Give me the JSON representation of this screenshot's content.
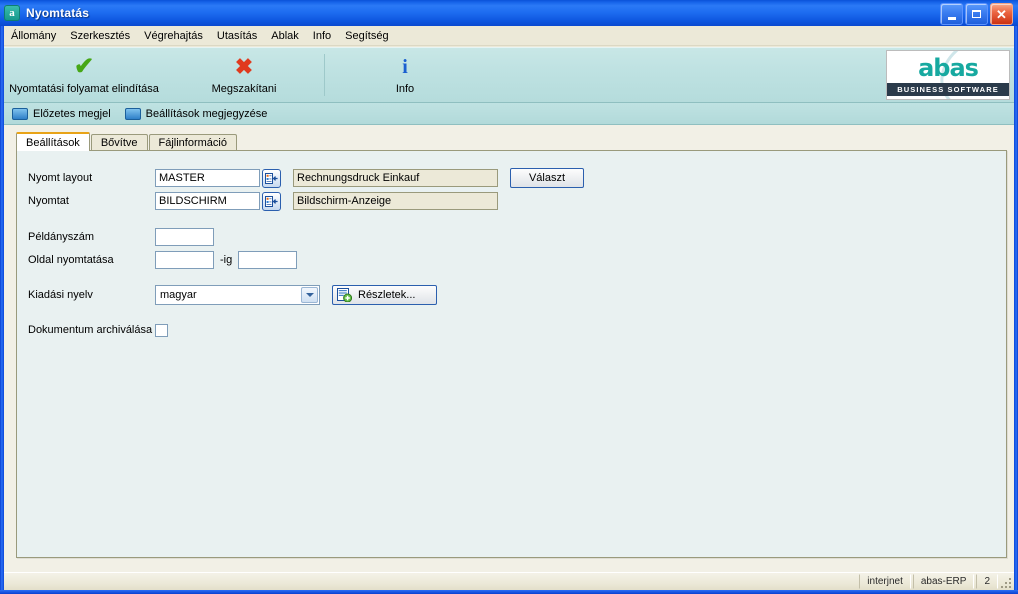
{
  "window": {
    "title": "Nyomtatás",
    "icon": "abas-app-icon",
    "controls": {
      "minimize": "minimize-icon",
      "maximize": "maximize-icon",
      "close": "close-icon"
    }
  },
  "menubar": {
    "items": [
      {
        "label": "Állomány"
      },
      {
        "label": "Szerkesztés"
      },
      {
        "label": "Végrehajtás"
      },
      {
        "label": "Utasítás"
      },
      {
        "label": "Ablak"
      },
      {
        "label": "Info"
      },
      {
        "label": "Segítség"
      }
    ]
  },
  "toolbar": {
    "buttons": [
      {
        "label": "Nyomtatási folyamat elindítása",
        "icon": "green-check-icon",
        "glyph": "✔"
      },
      {
        "label": "Megszakítani",
        "icon": "red-cross-icon",
        "glyph": "✖"
      },
      {
        "label": "Info",
        "icon": "info-icon",
        "glyph": "i"
      }
    ],
    "logo": {
      "word": "abas",
      "tagline": "BUSINESS SOFTWARE"
    }
  },
  "subbar": {
    "items": [
      {
        "label": "Előzetes megjel",
        "icon": "preview-toggle-icon"
      },
      {
        "label": "Beállítások megjegyzése",
        "icon": "save-settings-toggle-icon"
      }
    ]
  },
  "tabs": [
    {
      "label": "Beállítások",
      "active": true
    },
    {
      "label": "Bővítve",
      "active": false
    },
    {
      "label": "Fájlinformáció",
      "active": false
    }
  ],
  "form": {
    "print_layout": {
      "label": "Nyomt layout",
      "value": "MASTER",
      "description": "Rechnungsdruck Einkauf",
      "picker_icon": "list-select-icon",
      "select_button": "Választ"
    },
    "print_to": {
      "label": "Nyomtat",
      "value": "BILDSCHIRM",
      "description": "Bildschirm-Anzeige",
      "picker_icon": "list-select-icon"
    },
    "copies": {
      "label": "Példányszám",
      "value": ""
    },
    "pages": {
      "label": "Oldal nyomtatása",
      "from_value": "",
      "separator": "-ig",
      "to_value": ""
    },
    "language": {
      "label": "Kiadási nyelv",
      "value": "magyar",
      "options": [
        "magyar"
      ],
      "details_button": "Részletek...",
      "details_icon": "document-add-icon"
    },
    "archive": {
      "label": "Dokumentum archiválása",
      "checked": false
    }
  },
  "statusbar": {
    "cells": [
      "interjnet",
      "abas-ERP",
      "2"
    ]
  },
  "colors": {
    "titlebar": "#1d6cf0",
    "toolbar": "#bfe2e2",
    "panel": "#e9f1f1",
    "accent_tab": "#e8a317",
    "logo_teal": "#17a9a0",
    "status": "#ece9d8"
  }
}
